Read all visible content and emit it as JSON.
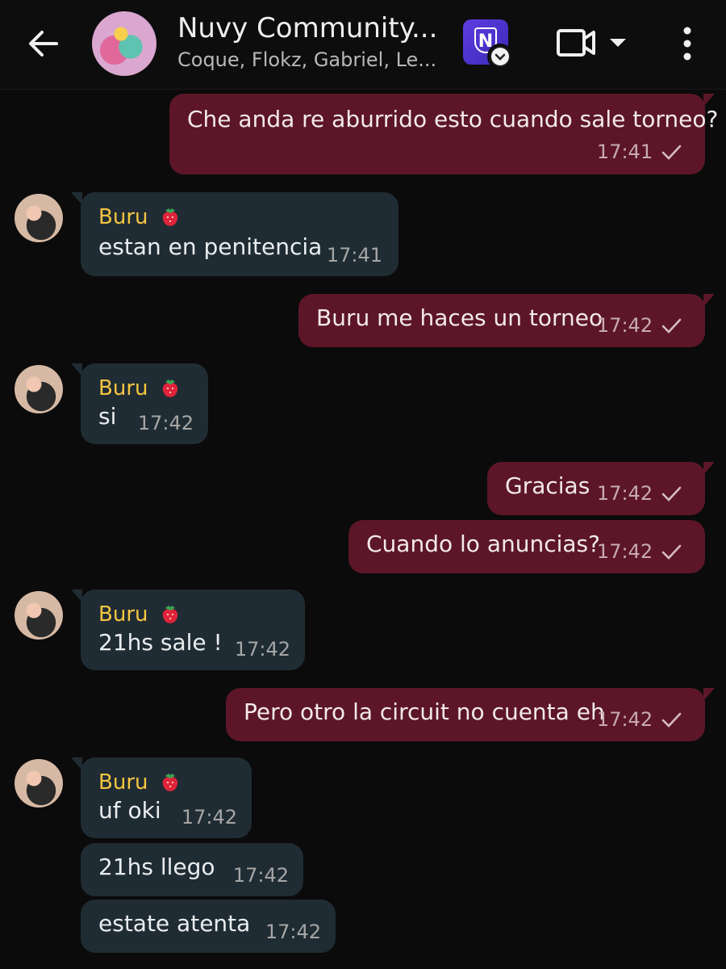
{
  "header": {
    "back_icon": "arrow-left-icon",
    "title": "Nuvy Community...",
    "subtitle": "Coque, Flokz, Gabriel, Le...",
    "app_icon": "community-app-icon",
    "video_icon": "video-call-icon",
    "more_icon": "more-vertical-icon"
  },
  "colors": {
    "background": "#0b0b0b",
    "outgoing_bubble": "#5c1628",
    "incoming_bubble": "#202c33",
    "sender_name": "#f4c542"
  },
  "messages": [
    {
      "dir": "out",
      "text": "Che anda re aburrido esto cuando sale torneo?",
      "time": "17:41"
    },
    {
      "dir": "in",
      "sender": "Buru",
      "text": "estan en penitencia",
      "time": "17:41"
    },
    {
      "dir": "out",
      "text": "Buru me haces un torneo",
      "time": "17:42"
    },
    {
      "dir": "in",
      "sender": "Buru",
      "text": "si",
      "time": "17:42"
    },
    {
      "dir": "out",
      "text": "Gracias",
      "time": "17:42"
    },
    {
      "dir": "out",
      "text": "Cuando lo anuncias?",
      "time": "17:42"
    },
    {
      "dir": "in",
      "sender": "Buru",
      "text": "21hs sale !",
      "time": "17:42"
    },
    {
      "dir": "out",
      "text": "Pero otro la circuit no cuenta eh",
      "time": "17:42"
    },
    {
      "dir": "in",
      "sender": "Buru",
      "text": "uf oki",
      "time": "17:42"
    },
    {
      "dir": "in",
      "text": "21hs llego",
      "time": "17:42"
    },
    {
      "dir": "in",
      "text": "estate atenta",
      "time": "17:42"
    }
  ]
}
